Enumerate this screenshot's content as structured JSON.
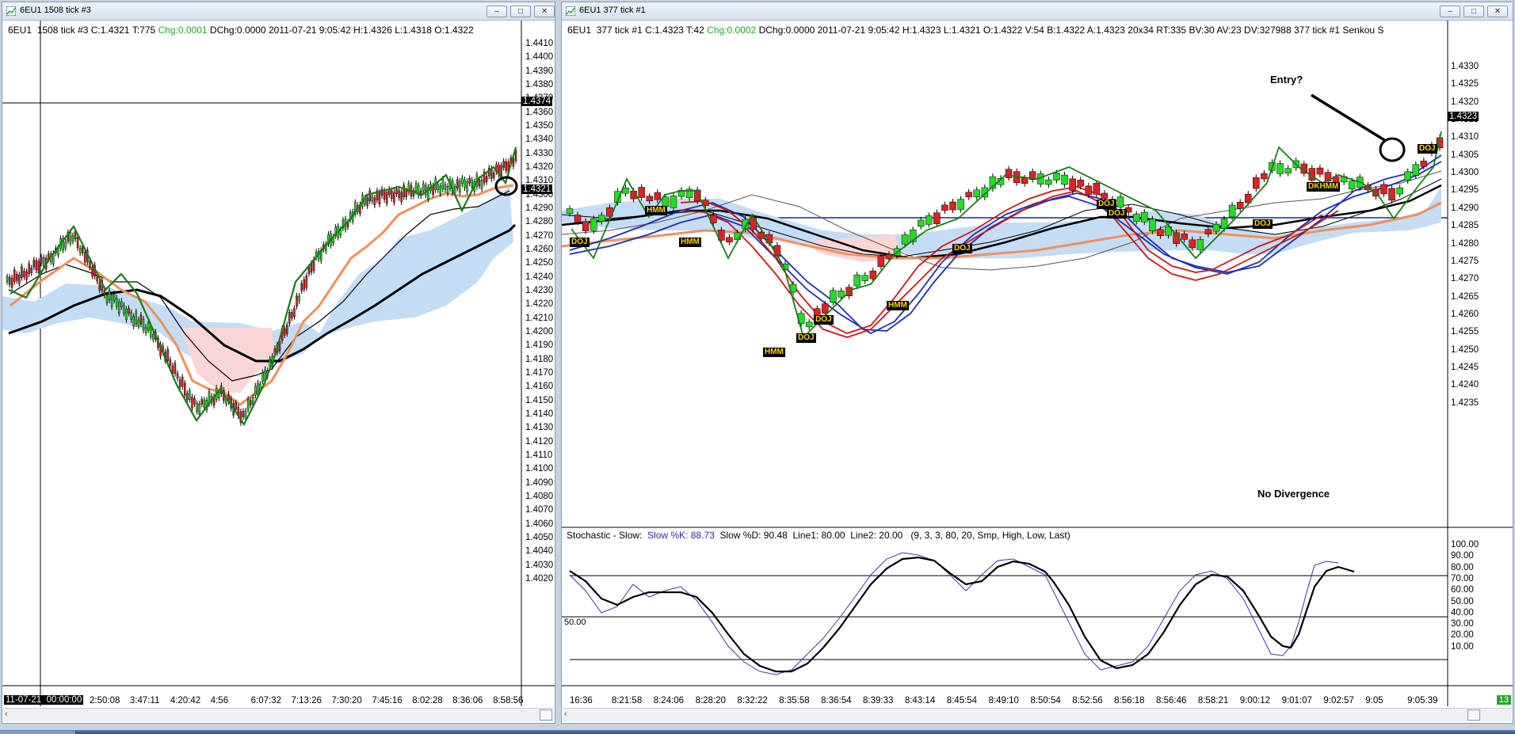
{
  "left": {
    "title": "6EU1  1508 tick  #3",
    "info": {
      "symbol": "6EU1",
      "period": "1508 tick  #3",
      "close": "C:1.4321",
      "ticks": "T:775",
      "chg": "Chg:0.0001",
      "rest": "DChg:0.0000  2011-07-21  9:05:42  H:1.4326  L:1.4318  O:1.4322"
    },
    "crosshair_price": "1.4374",
    "last_price": "1.4321",
    "date_label": "11-07-21  00:00:00",
    "price_labels": [
      "1.4410",
      "1.4400",
      "1.4390",
      "1.4380",
      "1.4370",
      "1.4360",
      "1.4350",
      "1.4340",
      "1.4330",
      "1.4320",
      "1.4310",
      "1.4300",
      "1.4290",
      "1.4280",
      "1.4270",
      "1.4260",
      "1.4250",
      "1.4240",
      "1.4230",
      "1.4220",
      "1.4210",
      "1.4200",
      "1.4190",
      "1.4180",
      "1.4170",
      "1.4160",
      "1.4150",
      "1.4140",
      "1.4130",
      "1.4120",
      "1.4110",
      "1.4100",
      "1.4090",
      "1.4080",
      "1.4070",
      "1.4060",
      "1.4050",
      "1.4040",
      "1.4030",
      "1.4020"
    ],
    "time_labels": [
      "2:50:08",
      "3:47:11",
      "4:20:42",
      "4:56",
      "6:07:32",
      "7:13:26",
      "7:30:20",
      "7:45:16",
      "8:02:28",
      "8:36:06",
      "8:58:56"
    ]
  },
  "right": {
    "title": "6EU1  377 tick  #1",
    "info": {
      "symbol": "6EU1",
      "period": "377 tick  #1",
      "close": "C:1.4323",
      "ticks": "T:42",
      "chg": "Chg:0.0002",
      "rest": "DChg:0.0000  2011-07-21  9:05:42  H:1.4323  L:1.4321  O:1.4322  V:54  B:1.4322  A:1.4323  20x34  RT:335  BV:30  AV:23  DV:327988  377 tick  #1   Senkou S"
    },
    "last_price": "1.4323",
    "price_labels": [
      "1.4330",
      "1.4325",
      "1.4320",
      "1.4315",
      "1.4310",
      "1.4305",
      "1.4300",
      "1.4295",
      "1.4290",
      "1.4285",
      "1.4280",
      "1.4275",
      "1.4270",
      "1.4265",
      "1.4260",
      "1.4255",
      "1.4250",
      "1.4245",
      "1.4240",
      "1.4235"
    ],
    "time_labels": [
      "16:36",
      "8:21:58",
      "8:24:06",
      "8:28:20",
      "8:32:22",
      "8:35:58",
      "8:36:54",
      "8:39:33",
      "8:43:14",
      "8:45:54",
      "8:49:10",
      "8:50:54",
      "8:52:56",
      "8:56:18",
      "8:56:46",
      "8:58:21",
      "9:00:12",
      "9:01:07",
      "9:02:57",
      "9:05",
      "9:05:39"
    ],
    "annotations": {
      "entry": "Entry?",
      "no_div": "No Divergence"
    },
    "pattern_labels": [
      "DOJ",
      "HMM",
      "HMM",
      "HMM",
      "DOJ",
      "DOJ",
      "HMM",
      "DOJ",
      "DOJ",
      "DOJ",
      "DOJ",
      "DKHMM",
      "DOJ"
    ],
    "stoch": {
      "title": "Stochastic - Slow:",
      "k": "Slow %K: 88.73",
      "d": "Slow %D: 90.48",
      "l1": "Line1: 80.00",
      "l2": "Line2: 20.00",
      "params": "(9, 3, 3, 80, 20, Smp, High, Low, Last)",
      "mid_label": "50.00",
      "labels": [
        "100.00",
        "90.00",
        "80.00",
        "70.00",
        "60.00",
        "50.00",
        "40.00",
        "30.00",
        "20.00",
        "10.00"
      ]
    },
    "scroll_badge": "13"
  },
  "colors": {
    "up": "#22dd22",
    "down": "#dd2222",
    "green_line": "#1a7a1a",
    "orange": "#f0905a",
    "cloud": "#c5dcf5",
    "cloud_red": "#f9d6d6",
    "blue_line": "#1b2fb5",
    "red_line": "#c81818",
    "chg_text": "#22aa22"
  }
}
